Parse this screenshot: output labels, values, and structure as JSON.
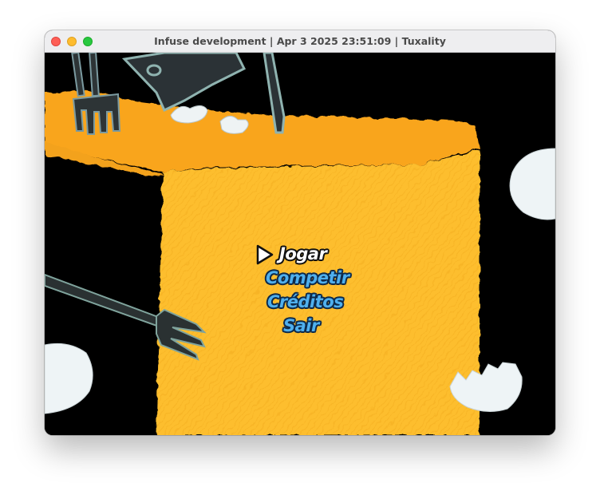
{
  "window": {
    "title": "Infuse development | Apr  3 2025 23:51:09 | Tuxality"
  },
  "menu": {
    "items": [
      {
        "label": "Jogar",
        "selected": true
      },
      {
        "label": "Competir",
        "selected": false
      },
      {
        "label": "Créditos",
        "selected": false
      },
      {
        "label": "Sair",
        "selected": false
      }
    ],
    "cursor_icon": "play-arrow-icon"
  },
  "colors": {
    "background": "#000000",
    "cheese": "#fdbe2e",
    "menu_selected": "#ffffff",
    "menu_normal": "#4fb0ee"
  }
}
